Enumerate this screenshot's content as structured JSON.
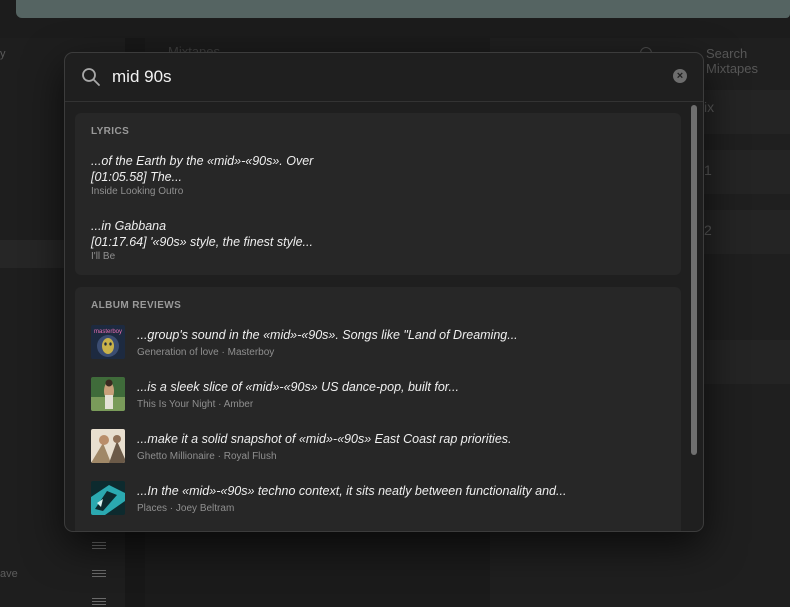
{
  "background": {
    "title_fragment": "Mixtapes",
    "search_placeholder": "Search Mixtapes",
    "left_label": "ave",
    "left_label_top": "y",
    "right_peek": [
      "ix",
      "1",
      "2"
    ]
  },
  "search": {
    "query": "mid 90s"
  },
  "sections": {
    "lyrics": {
      "title": "LYRICS",
      "items": [
        {
          "snippet_1": "...of the Earth by the «mid»-«90s». Over",
          "snippet_2": "[01:05.58] The...",
          "track": "Inside Looking Outro"
        },
        {
          "snippet_1": "...in Gabbana",
          "snippet_2": "[01:17.64] '«90s» style, the finest style...",
          "track": "I'll Be"
        }
      ]
    },
    "reviews": {
      "title": "ALBUM REVIEWS",
      "items": [
        {
          "snippet": "...group's sound in the «mid»-«90s». Songs like \"Land of Dreaming...",
          "album": "Generation of love",
          "artist": "Masterboy"
        },
        {
          "snippet": "...is a sleek slice of «mid»-«90s» US dance-pop, built for...",
          "album": "This Is Your Night",
          "artist": "Amber"
        },
        {
          "snippet": "...make it a solid snapshot of «mid»-«90s» East Coast rap priorities.",
          "album": "Ghetto Millionaire",
          "artist": "Royal Flush"
        },
        {
          "snippet": "...In the «mid»-«90s» techno context, it sits neatly between functionality and...",
          "album": "Places",
          "artist": "Joey Beltram"
        }
      ]
    }
  },
  "separator": "·",
  "cover_art_logo": "masterboy"
}
